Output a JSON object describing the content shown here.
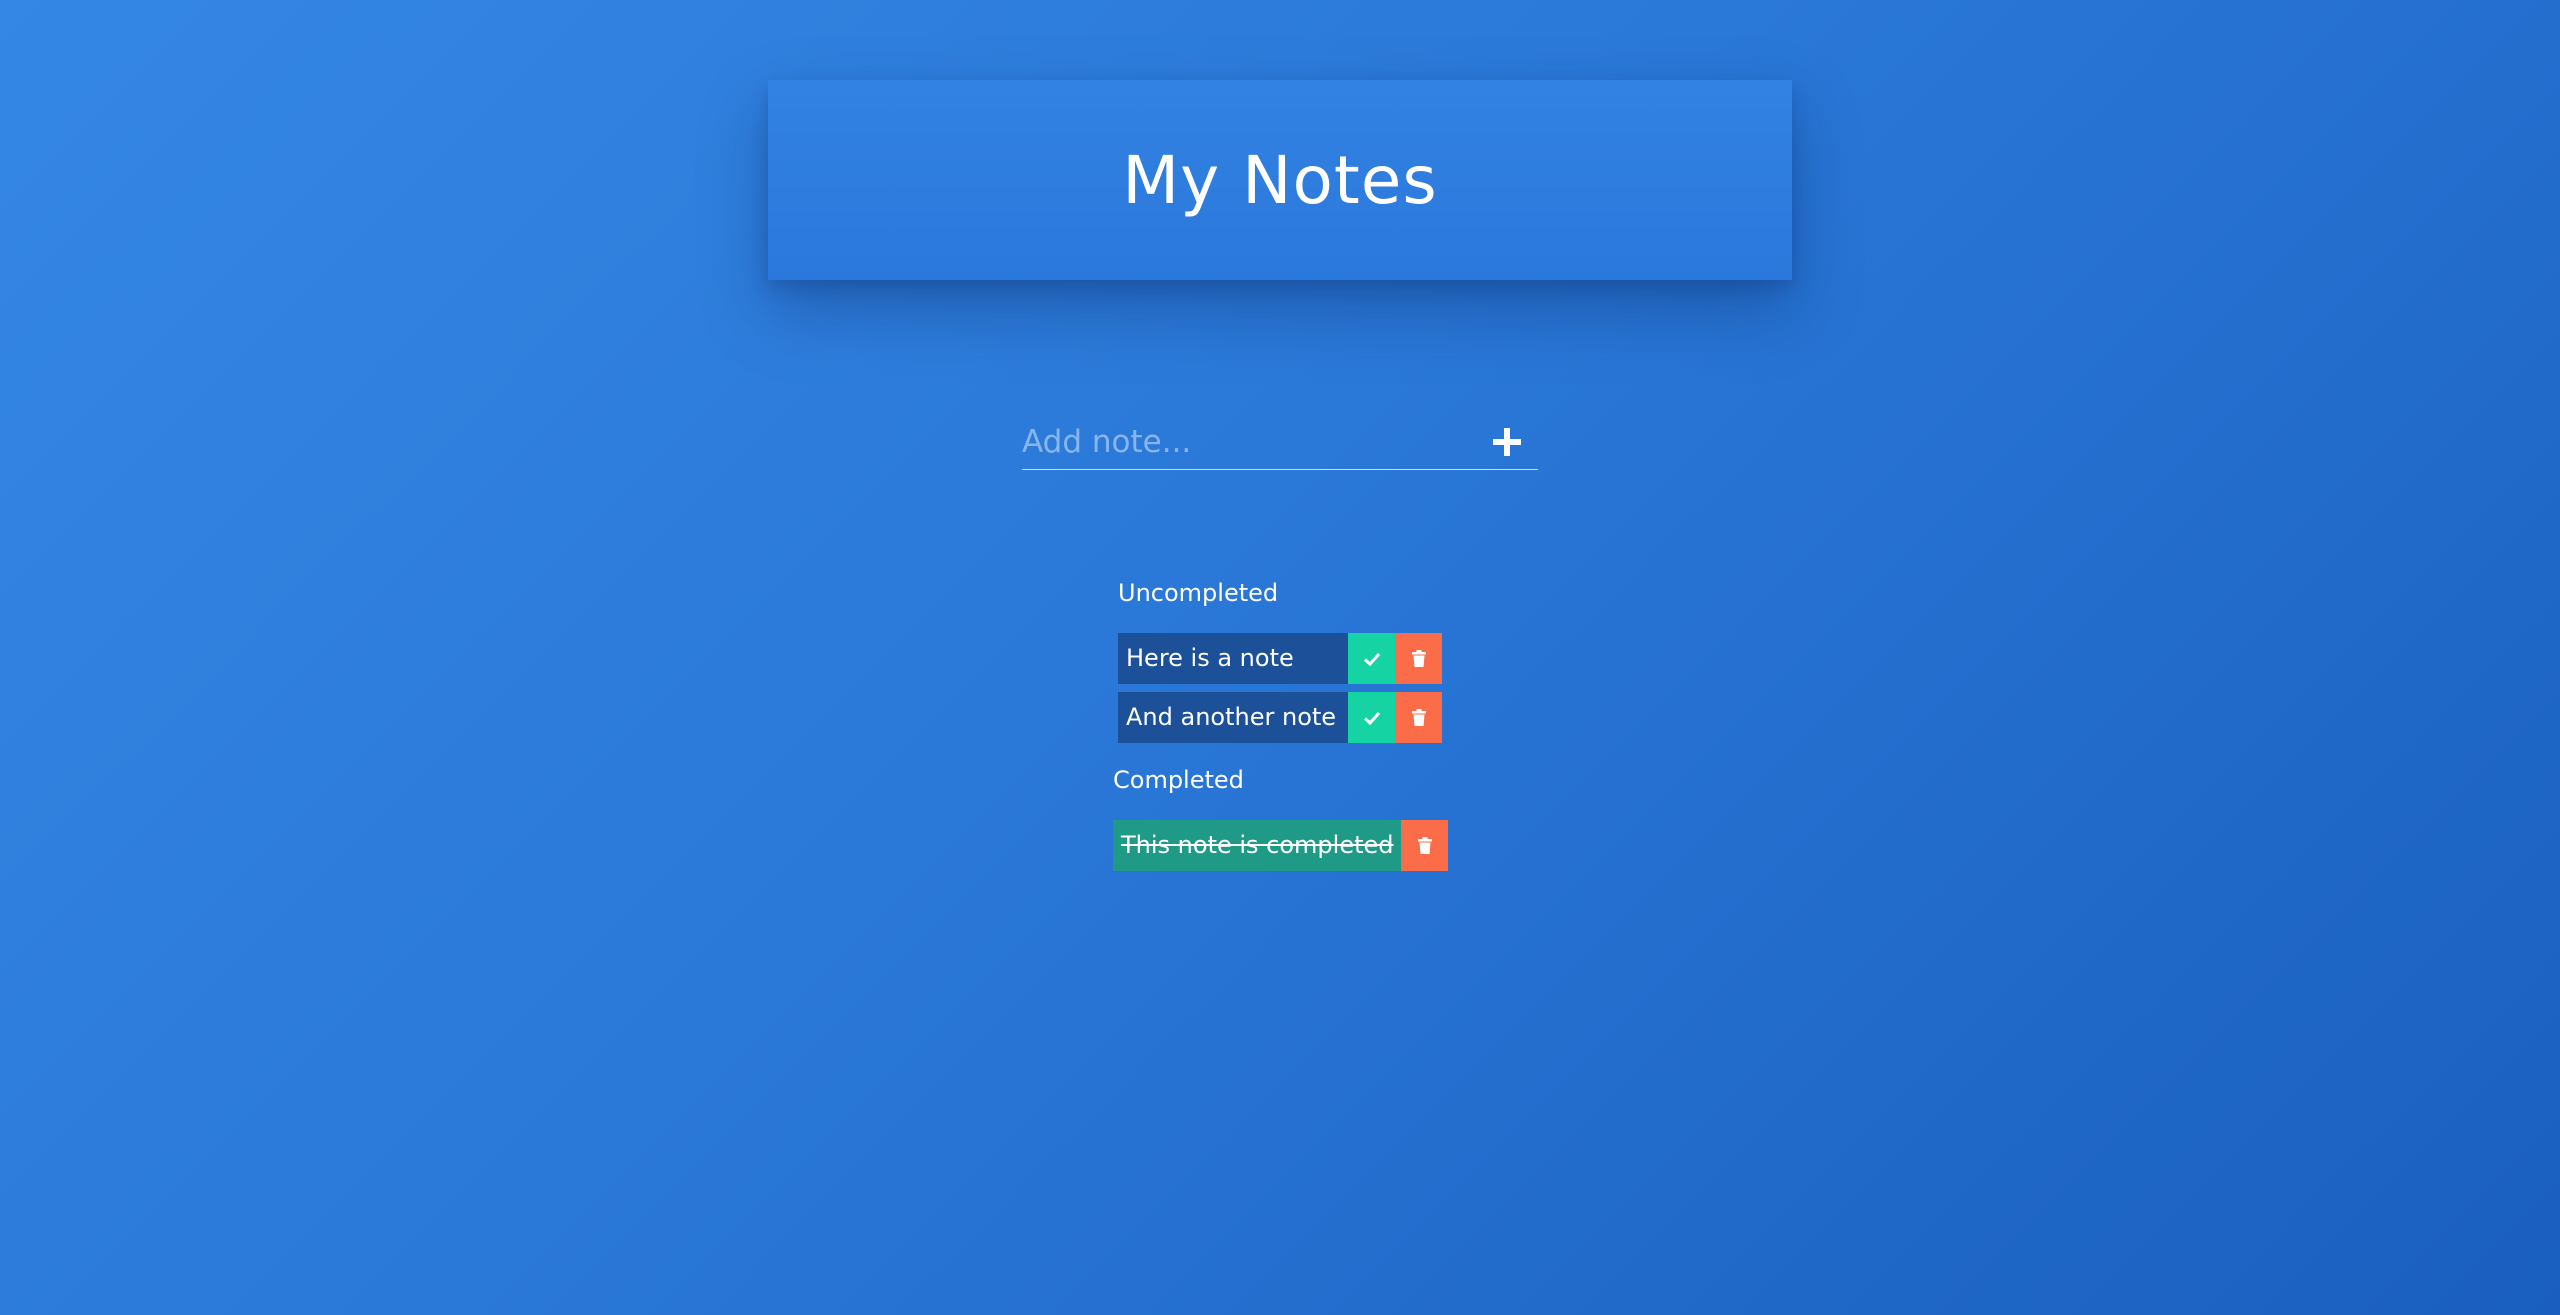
{
  "header": {
    "title": "My Notes"
  },
  "add_form": {
    "placeholder": "Add note...",
    "value": "",
    "add_icon": "plus-icon"
  },
  "sections": {
    "uncompleted_label": "Uncompleted",
    "completed_label": "Completed"
  },
  "notes": {
    "uncompleted": [
      {
        "text": "Here is a note"
      },
      {
        "text": "And another note"
      }
    ],
    "completed": [
      {
        "text": "This note is completed"
      }
    ]
  },
  "icons": {
    "complete": "check-icon",
    "delete": "trash-icon",
    "add": "plus-icon"
  },
  "colors": {
    "background": "#2a78d8",
    "header": "#2f80e0",
    "note_uncompleted": "#1c5199",
    "note_completed": "#1f9a87",
    "complete_button": "#16d3a3",
    "delete_button": "#fb6d49"
  }
}
